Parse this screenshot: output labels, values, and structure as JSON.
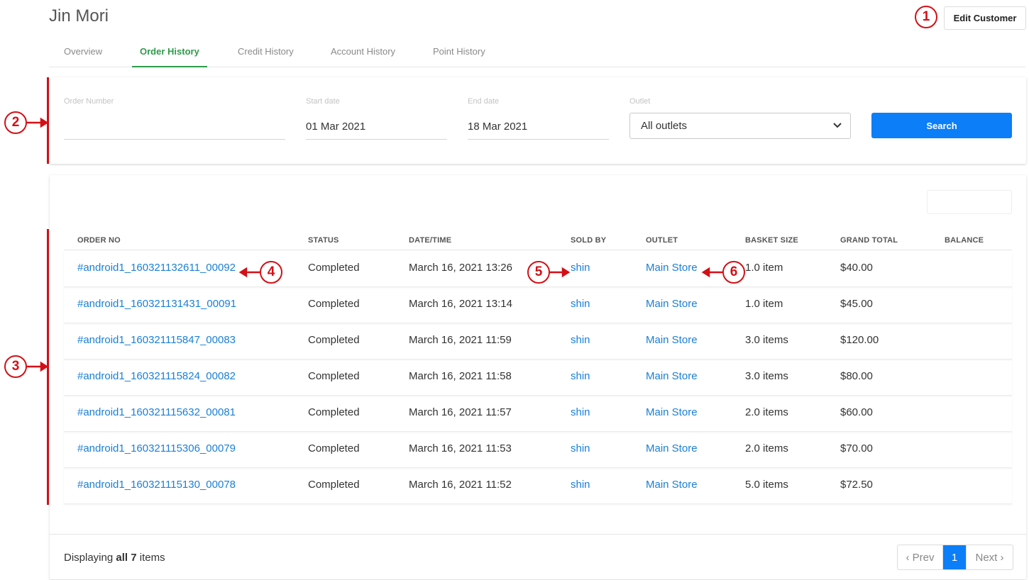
{
  "header": {
    "customer_name": "Jin Mori",
    "edit_button": "Edit Customer"
  },
  "tabs": [
    {
      "label": "Overview",
      "active": false
    },
    {
      "label": "Order History",
      "active": true
    },
    {
      "label": "Credit History",
      "active": false
    },
    {
      "label": "Account History",
      "active": false
    },
    {
      "label": "Point History",
      "active": false
    }
  ],
  "filters": {
    "order_number": {
      "label": "Order Number",
      "value": ""
    },
    "start_date": {
      "label": "Start date",
      "value": "01 Mar 2021"
    },
    "end_date": {
      "label": "End date",
      "value": "18 Mar 2021"
    },
    "outlet": {
      "label": "Outlet",
      "selected": "All outlets"
    },
    "search_button": "Search"
  },
  "table": {
    "columns": [
      "ORDER NO",
      "STATUS",
      "DATE/TIME",
      "SOLD BY",
      "OUTLET",
      "BASKET SIZE",
      "GRAND TOTAL",
      "BALANCE"
    ],
    "rows": [
      {
        "order_no": "#android1_160321132611_00092",
        "status": "Completed",
        "datetime": "March 16, 2021 13:26",
        "sold_by": "shin",
        "outlet": "Main Store",
        "basket": "1.0 item",
        "total": "$40.00",
        "balance": ""
      },
      {
        "order_no": "#android1_160321131431_00091",
        "status": "Completed",
        "datetime": "March 16, 2021 13:14",
        "sold_by": "shin",
        "outlet": "Main Store",
        "basket": "1.0 item",
        "total": "$45.00",
        "balance": ""
      },
      {
        "order_no": "#android1_160321115847_00083",
        "status": "Completed",
        "datetime": "March 16, 2021 11:59",
        "sold_by": "shin",
        "outlet": "Main Store",
        "basket": "3.0 items",
        "total": "$120.00",
        "balance": ""
      },
      {
        "order_no": "#android1_160321115824_00082",
        "status": "Completed",
        "datetime": "March 16, 2021 11:58",
        "sold_by": "shin",
        "outlet": "Main Store",
        "basket": "3.0 items",
        "total": "$80.00",
        "balance": ""
      },
      {
        "order_no": "#android1_160321115632_00081",
        "status": "Completed",
        "datetime": "March 16, 2021 11:57",
        "sold_by": "shin",
        "outlet": "Main Store",
        "basket": "2.0 items",
        "total": "$60.00",
        "balance": ""
      },
      {
        "order_no": "#android1_160321115306_00079",
        "status": "Completed",
        "datetime": "March 16, 2021 11:53",
        "sold_by": "shin",
        "outlet": "Main Store",
        "basket": "2.0 items",
        "total": "$70.00",
        "balance": ""
      },
      {
        "order_no": "#android1_160321115130_00078",
        "status": "Completed",
        "datetime": "March 16, 2021 11:52",
        "sold_by": "shin",
        "outlet": "Main Store",
        "basket": "5.0 items",
        "total": "$72.50",
        "balance": ""
      }
    ]
  },
  "footer": {
    "displaying_prefix": "Displaying",
    "displaying_bold": "all 7",
    "displaying_suffix": "items"
  },
  "pagination": {
    "prev": "‹ Prev",
    "current": "1",
    "next": "Next ›"
  },
  "annotations": [
    "1",
    "2",
    "3",
    "4",
    "5",
    "6"
  ],
  "colors": {
    "accent_green": "#2e9a4a",
    "primary_blue": "#0b7ef8",
    "link_blue": "#1a7fd6",
    "annotation_red": "#d31016"
  }
}
